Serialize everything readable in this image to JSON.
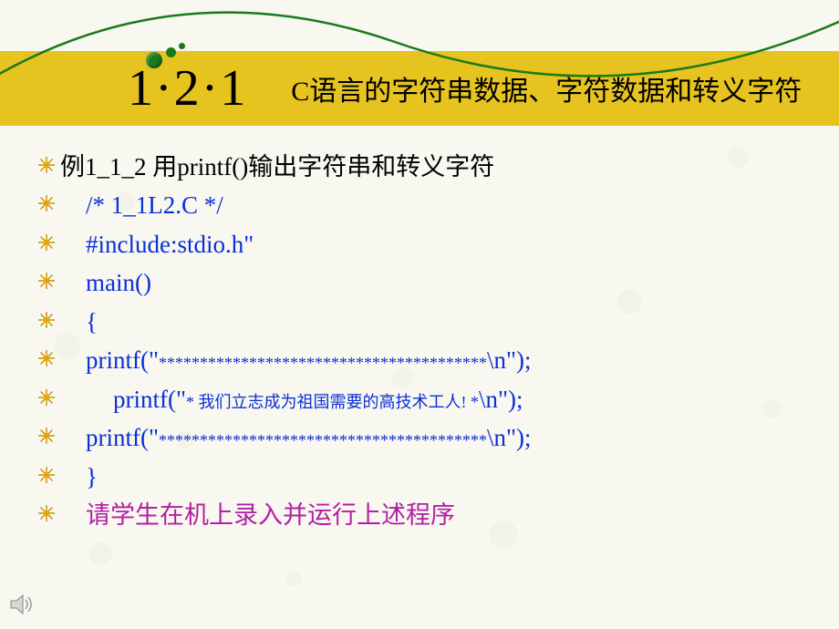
{
  "title": {
    "number": "1·2·1",
    "text": "C语言的字符串数据、字符数据和转义字符"
  },
  "lines": [
    {
      "cls": "black",
      "indent": "",
      "text": "例1_1_2   用printf()输出字符串和转义字符"
    },
    {
      "cls": "blue",
      "indent": "indent1",
      "text": "/*      1_1L2.C       */"
    },
    {
      "cls": "blue",
      "indent": "indent1",
      "text": "#include:stdio.h\""
    },
    {
      "cls": "blue",
      "indent": "indent1",
      "text": "main()"
    },
    {
      "cls": "blue",
      "indent": "indent1",
      "text": "{"
    },
    {
      "cls": "blue",
      "indent": "indent1",
      "prefix": "printf(\"",
      "inner": "****************************************",
      "suffix": "\\n\");"
    },
    {
      "cls": "blue",
      "indent": "indent2",
      "prefix": "printf(\"",
      "inner": "*  我们立志成为祖国需要的高技术工人!  *",
      "suffix": "\\n\");"
    },
    {
      "cls": "blue",
      "indent": "indent1",
      "prefix": "printf(\"",
      "inner": "****************************************",
      "suffix": "\\n\");"
    },
    {
      "cls": "blue",
      "indent": "indent1",
      "text": "}"
    },
    {
      "cls": "magenta",
      "indent": "indent1",
      "text": "请学生在机上录入并运行上述程序"
    }
  ]
}
